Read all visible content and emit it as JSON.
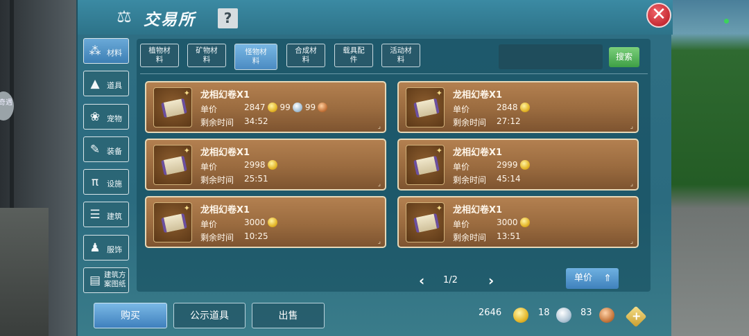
{
  "window": {
    "title": "交易所",
    "help": "?",
    "close": "✕"
  },
  "side_badge": "奇遇",
  "categories": [
    {
      "label": "材料",
      "icon": "materials-icon",
      "glyph": "⁂",
      "active": true
    },
    {
      "label": "道具",
      "icon": "item-icon",
      "glyph": "▲",
      "active": false
    },
    {
      "label": "宠物",
      "icon": "paw-icon",
      "glyph": "❀",
      "active": false
    },
    {
      "label": "装备",
      "icon": "equipment-icon",
      "glyph": "✎",
      "active": false
    },
    {
      "label": "设施",
      "icon": "facility-icon",
      "glyph": "π",
      "active": false
    },
    {
      "label": "建筑",
      "icon": "building-icon",
      "glyph": "☰",
      "active": false
    },
    {
      "label": "服饰",
      "icon": "clothing-icon",
      "glyph": "♟",
      "active": false
    },
    {
      "label": "建筑方案图纸",
      "line1": "建筑方",
      "line2": "案图纸",
      "icon": "blueprint-icon",
      "glyph": "▤",
      "active": false
    }
  ],
  "subtabs": [
    {
      "line1": "植物材",
      "line2": "料",
      "active": false
    },
    {
      "line1": "矿物材",
      "line2": "料",
      "active": false
    },
    {
      "line1": "怪物材",
      "line2": "料",
      "active": true
    },
    {
      "line1": "合成材",
      "line2": "料",
      "active": false
    },
    {
      "line1": "载具配",
      "line2": "件",
      "active": false
    },
    {
      "line1": "活动材",
      "line2": "料",
      "active": false
    }
  ],
  "search": {
    "value": "",
    "button": "搜索"
  },
  "listing_labels": {
    "price": "单价",
    "time": "剩余时间"
  },
  "listings": [
    {
      "name": "龙相幻卷X1",
      "gold": "2847",
      "silver": "99",
      "copper": "99",
      "time": "34:52"
    },
    {
      "name": "龙相幻卷X1",
      "gold": "2848",
      "time": "27:12"
    },
    {
      "name": "龙相幻卷X1",
      "gold": "2998",
      "time": "25:51"
    },
    {
      "name": "龙相幻卷X1",
      "gold": "2999",
      "time": "45:14"
    },
    {
      "name": "龙相幻卷X1",
      "gold": "3000",
      "time": "10:25"
    },
    {
      "name": "龙相幻卷X1",
      "gold": "3000",
      "time": "13:51"
    }
  ],
  "pagination": {
    "prev": "‹",
    "page": "1/2",
    "next": "›"
  },
  "sort_button": {
    "label": "单价",
    "icon": "sort-up-icon",
    "glyph": "⇑"
  },
  "actions": {
    "buy": "购买",
    "showcase": "公示道具",
    "sell": "出售"
  },
  "wallet": {
    "gold": "2646",
    "silver": "18",
    "copper": "83",
    "add": "+"
  },
  "colors": {
    "panel": "#2f6f84",
    "card": "#b38050",
    "accent": "#4b8bc2",
    "search": "#3e9e45",
    "close": "#c72b34"
  }
}
